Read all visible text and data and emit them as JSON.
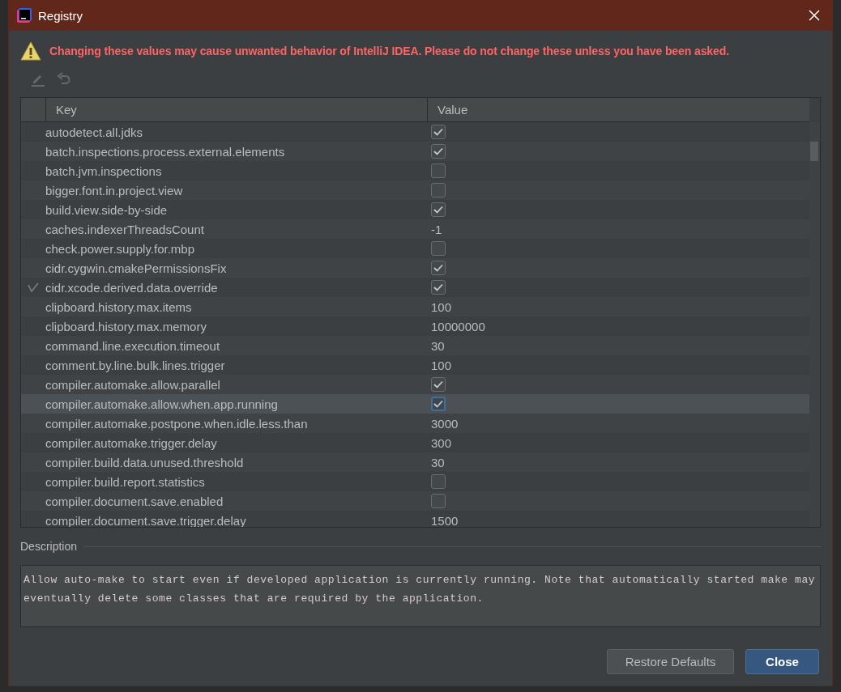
{
  "window": {
    "title": "Registry"
  },
  "warning": "Changing these values may cause unwanted behavior of IntelliJ IDEA. Please do not change these unless you have been asked.",
  "toolbar": {
    "edit_disabled": true,
    "revert_disabled": true
  },
  "table": {
    "columns": [
      "Key",
      "Value"
    ],
    "rows": [
      {
        "key": "autodetect.all.jdks",
        "kind": "checkbox",
        "checked": true,
        "modified": false,
        "selected": false
      },
      {
        "key": "batch.inspections.process.external.elements",
        "kind": "checkbox",
        "checked": true,
        "modified": false,
        "selected": false
      },
      {
        "key": "batch.jvm.inspections",
        "kind": "checkbox",
        "checked": false,
        "modified": false,
        "selected": false
      },
      {
        "key": "bigger.font.in.project.view",
        "kind": "checkbox",
        "checked": false,
        "modified": false,
        "selected": false
      },
      {
        "key": "build.view.side-by-side",
        "kind": "checkbox",
        "checked": true,
        "modified": false,
        "selected": false
      },
      {
        "key": "caches.indexerThreadsCount",
        "kind": "text",
        "value": "-1",
        "modified": false,
        "selected": false
      },
      {
        "key": "check.power.supply.for.mbp",
        "kind": "checkbox",
        "checked": false,
        "modified": false,
        "selected": false
      },
      {
        "key": "cidr.cygwin.cmakePermissionsFix",
        "kind": "checkbox",
        "checked": true,
        "modified": false,
        "selected": false
      },
      {
        "key": "cidr.xcode.derived.data.override",
        "kind": "checkbox",
        "checked": true,
        "modified": true,
        "selected": false
      },
      {
        "key": "clipboard.history.max.items",
        "kind": "text",
        "value": "100",
        "modified": false,
        "selected": false
      },
      {
        "key": "clipboard.history.max.memory",
        "kind": "text",
        "value": "10000000",
        "modified": false,
        "selected": false
      },
      {
        "key": "command.line.execution.timeout",
        "kind": "text",
        "value": "30",
        "modified": false,
        "selected": false
      },
      {
        "key": "comment.by.line.bulk.lines.trigger",
        "kind": "text",
        "value": "100",
        "modified": false,
        "selected": false
      },
      {
        "key": "compiler.automake.allow.parallel",
        "kind": "checkbox",
        "checked": true,
        "modified": false,
        "selected": false
      },
      {
        "key": "compiler.automake.allow.when.app.running",
        "kind": "checkbox",
        "checked": true,
        "modified": false,
        "selected": true
      },
      {
        "key": "compiler.automake.postpone.when.idle.less.than",
        "kind": "text",
        "value": "3000",
        "modified": false,
        "selected": false
      },
      {
        "key": "compiler.automake.trigger.delay",
        "kind": "text",
        "value": "300",
        "modified": false,
        "selected": false
      },
      {
        "key": "compiler.build.data.unused.threshold",
        "kind": "text",
        "value": "30",
        "modified": false,
        "selected": false
      },
      {
        "key": "compiler.build.report.statistics",
        "kind": "checkbox",
        "checked": false,
        "modified": false,
        "selected": false
      },
      {
        "key": "compiler.document.save.enabled",
        "kind": "checkbox",
        "checked": false,
        "modified": false,
        "selected": false
      },
      {
        "key": "compiler.document.save.trigger.delay",
        "kind": "text",
        "value": "1500",
        "modified": false,
        "selected": false
      }
    ]
  },
  "description": {
    "label": "Description",
    "text": "Allow auto-make to start even if developed application is currently running. Note that automatically started make may eventually delete some classes that are required by the application."
  },
  "buttons": [
    {
      "label": "Restore Defaults",
      "default": false
    },
    {
      "label": "Close",
      "default": true
    }
  ]
}
